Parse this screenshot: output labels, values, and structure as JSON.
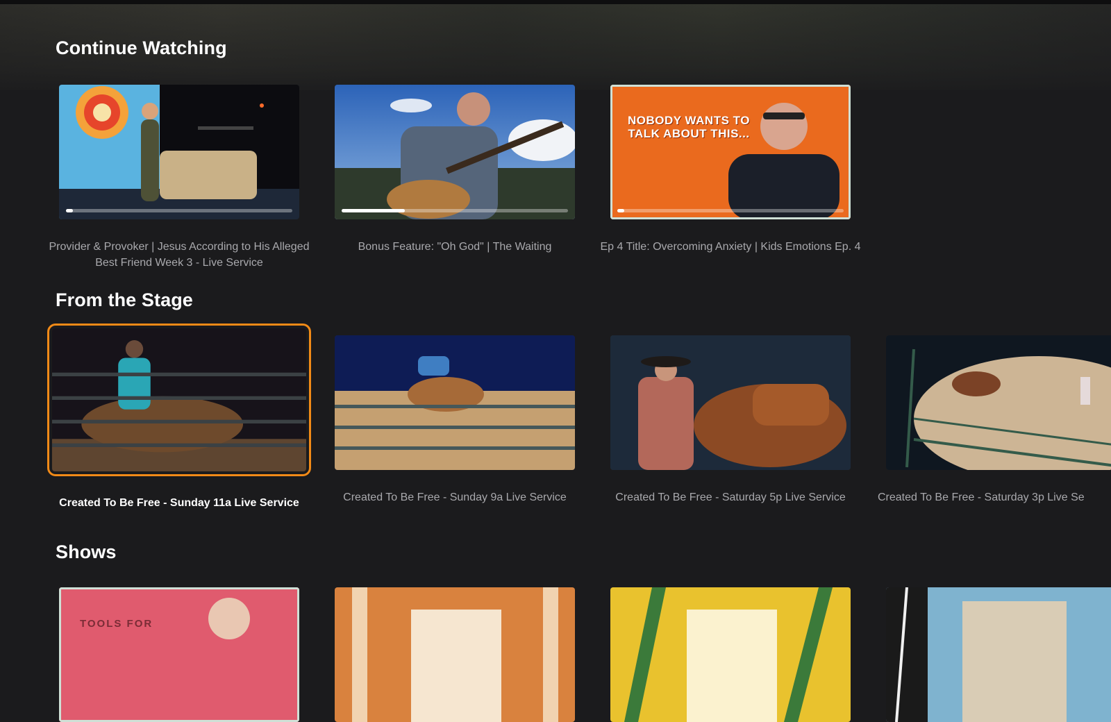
{
  "sections": {
    "continue_watching": {
      "title": "Continue Watching",
      "items": [
        {
          "caption": "Provider & Provoker | Jesus According to His Alleged Best Friend Week 3 - Live Service",
          "progress": 0.03
        },
        {
          "caption": "Bonus Feature: \"Oh God\" | The Waiting",
          "progress": 0.28
        },
        {
          "caption": "Ep 4 Title: Overcoming Anxiety | Kids Emotions Ep. 4",
          "progress": 0.03,
          "overlay": "NOBODY WANTS TO TALK ABOUT THIS..."
        }
      ]
    },
    "from_the_stage": {
      "title": "From the Stage",
      "items": [
        {
          "caption": "Created To Be Free - Sunday 11a Live Service",
          "focused": true
        },
        {
          "caption": "Created To Be Free - Sunday 9a Live Service"
        },
        {
          "caption": "Created To Be Free - Saturday 5p Live Service"
        },
        {
          "caption": "Created To Be Free - Saturday 3p Live Se"
        }
      ]
    },
    "shows": {
      "title": "Shows",
      "items": [
        {
          "text": "TOOLS FOR"
        },
        {
          "text": ""
        },
        {
          "text": ""
        },
        {
          "text": ""
        }
      ]
    }
  },
  "colors": {
    "background": "#1b1b1d",
    "focus": "#f28a17",
    "caption": "#a9a9ad",
    "progress_fill": "#ffffff"
  }
}
